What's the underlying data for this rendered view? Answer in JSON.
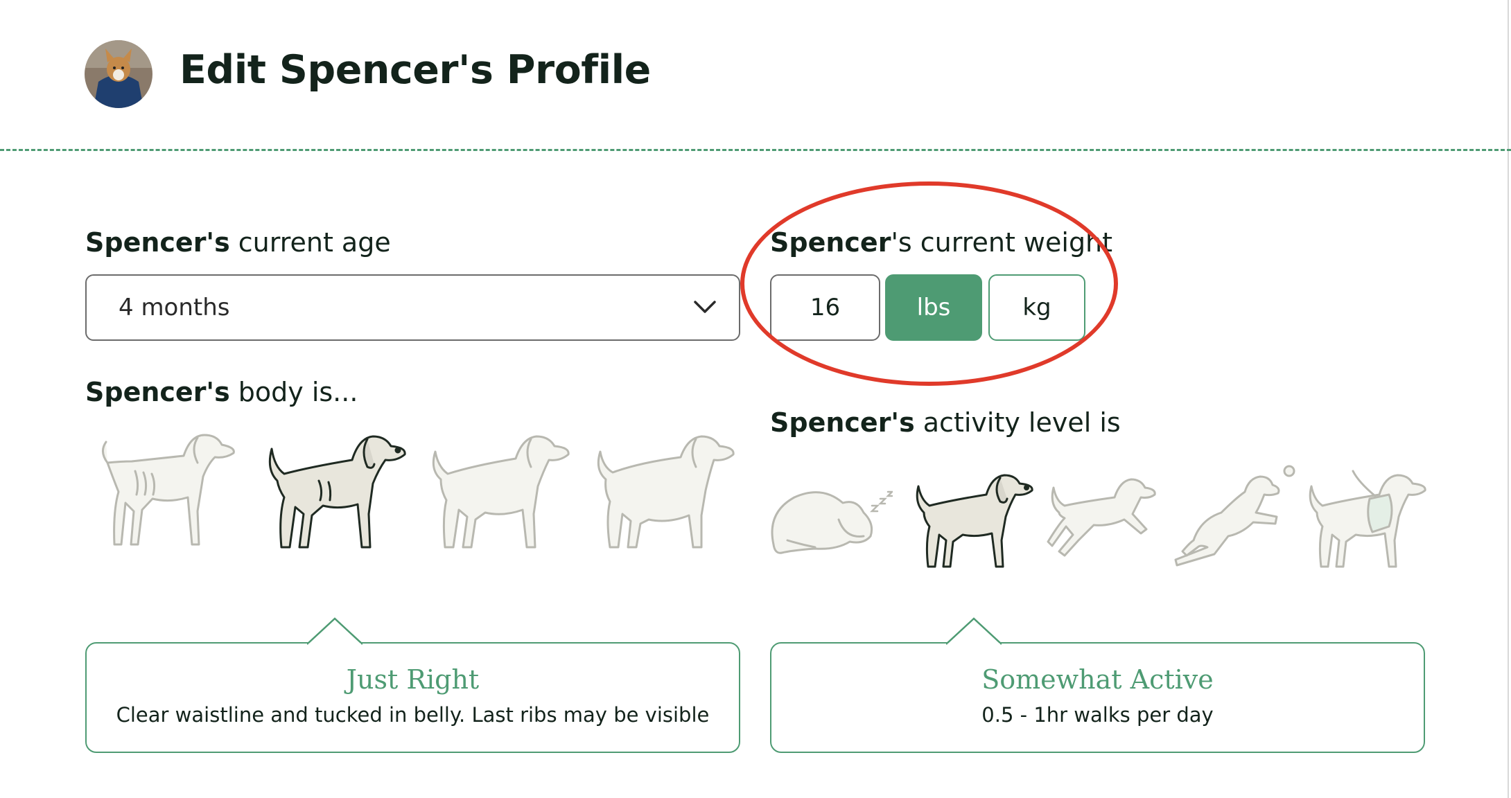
{
  "header": {
    "title": "Edit Spencer's Profile"
  },
  "age": {
    "label_name": "Spencer's",
    "label_rest": " current age",
    "selected": "4 months"
  },
  "weight": {
    "label_name": "Spencer",
    "label_rest": "'s current weight",
    "value": "16",
    "unit_lbs": "lbs",
    "unit_kg": "kg",
    "selected_unit": "lbs"
  },
  "body": {
    "label_name": "Spencer's",
    "label_rest": " body is...",
    "options": [
      "too-thin-dog-icon",
      "just-right-dog-icon",
      "a-bit-chubby-dog-icon",
      "overweight-dog-icon"
    ],
    "selected_index": 1,
    "selected_title": "Just Right",
    "selected_desc": "Clear waistline and tucked in belly. Last ribs may be visible"
  },
  "activity": {
    "label_name": "Spencer's",
    "label_rest": " activity level is",
    "options": [
      "sleeping-dog-icon",
      "standing-dog-icon",
      "walking-dog-icon",
      "jumping-dog-icon",
      "working-dog-icon"
    ],
    "selected_index": 1,
    "selected_title": "Somewhat Active",
    "selected_desc": "0.5 - 1hr walks per day"
  },
  "colors": {
    "accent": "#4e9b73",
    "text": "#13231b",
    "annotation": "#e03a2a",
    "dog_fill_selected": "#e8e6dc",
    "dog_fill_unselected": "#f4f4ef"
  }
}
